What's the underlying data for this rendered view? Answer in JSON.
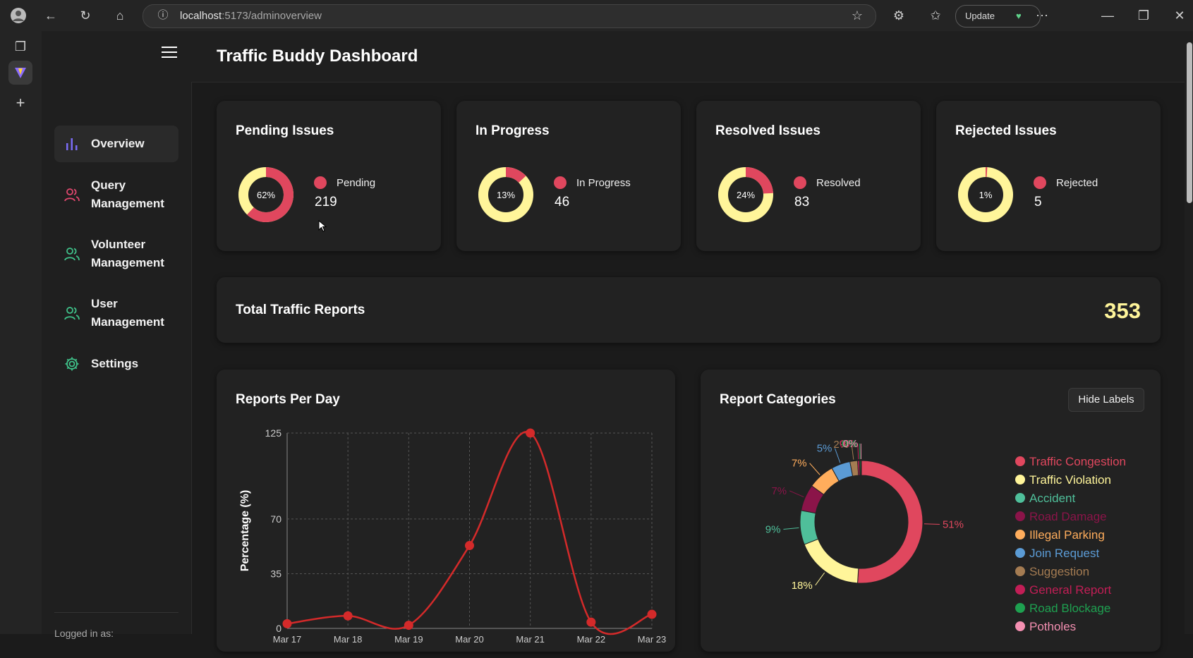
{
  "browser": {
    "url_host": "localhost",
    "url_path": ":5173/adminoverview",
    "update_label": "Update"
  },
  "app": {
    "title": "Traffic Buddy Dashboard"
  },
  "sidebar": {
    "items": [
      {
        "label": "Overview",
        "active": true,
        "icon": "bar-chart-icon"
      },
      {
        "label": "Query Management",
        "icon": "users-icon"
      },
      {
        "label": "Volunteer Management",
        "icon": "users-icon"
      },
      {
        "label": "User Management",
        "icon": "user-icon"
      },
      {
        "label": "Settings",
        "icon": "gear-icon"
      }
    ],
    "footer_text": "Logged in as:"
  },
  "stats": [
    {
      "title": "Pending Issues",
      "percent": 62,
      "percent_label": "62%",
      "legend": "Pending",
      "value": "219"
    },
    {
      "title": "In Progress",
      "percent": 13,
      "percent_label": "13%",
      "legend": "In Progress",
      "value": "46"
    },
    {
      "title": "Resolved Issues",
      "percent": 24,
      "percent_label": "24%",
      "legend": "Resolved",
      "value": "83"
    },
    {
      "title": "Rejected Issues",
      "percent": 1,
      "percent_label": "1%",
      "legend": "Rejected",
      "value": "5"
    }
  ],
  "total": {
    "label": "Total Traffic Reports",
    "value": "353"
  },
  "reports_per_day": {
    "title": "Reports Per Day"
  },
  "categories_card": {
    "title": "Report Categories",
    "hide_labels": "Hide Labels"
  },
  "colors": {
    "red": "#e0475e",
    "yellow": "#fff59a",
    "accent_line": "#d42a2a"
  },
  "chart_data": [
    {
      "type": "line",
      "title": "Reports Per Day",
      "ylabel": "Percentage (%)",
      "ylim": [
        0,
        125
      ],
      "yticks": [
        0,
        35,
        70,
        125
      ],
      "x": [
        "Mar 17",
        "Mar 18",
        "Mar 19",
        "Mar 20",
        "Mar 21",
        "Mar 22",
        "Mar 23"
      ],
      "x_visible_labels": [
        "Mar 17",
        "Mar 18",
        "Mar 19",
        "Mar 20",
        "Mar 21",
        "Mar 22",
        "Mar 23"
      ],
      "values": [
        3,
        8,
        2,
        53,
        125,
        4,
        9
      ],
      "grid": true
    },
    {
      "type": "pie",
      "title": "Report Categories",
      "categories": [
        "Traffic Congestion",
        "Traffic Violation",
        "Accident",
        "Road Damage",
        "Illegal Parking",
        "Join Request",
        "Suggestion",
        "General Report",
        "Road Blockage",
        "Potholes"
      ],
      "colors": [
        "#e0475e",
        "#fff59a",
        "#4fbf9a",
        "#8b1449",
        "#ffad5c",
        "#5b9bd5",
        "#a57c52",
        "#c21e56",
        "#1ea050",
        "#f48fb1"
      ],
      "values": [
        51,
        18,
        9,
        7,
        7,
        5,
        2,
        0.5,
        0.3,
        0.2
      ],
      "labels": [
        "51%",
        "18%",
        "9%",
        "7%",
        "7%",
        "5%",
        "2%",
        "0%",
        "0%",
        "0%"
      ],
      "legend": "right"
    }
  ]
}
